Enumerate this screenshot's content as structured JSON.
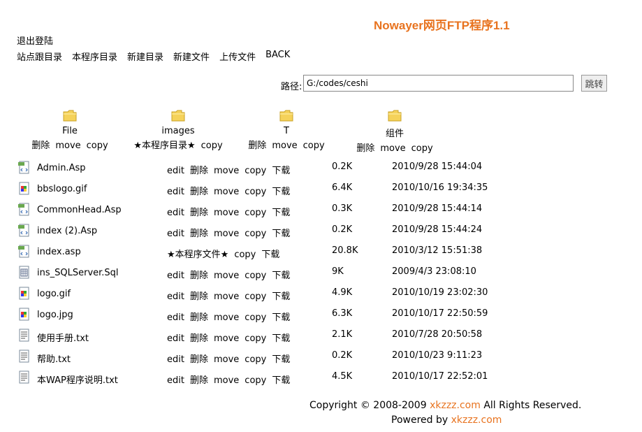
{
  "header": {
    "title": "Nowayer网页FTP程序1.1"
  },
  "top": {
    "logout": "退出登陆"
  },
  "nav": [
    "站点跟目录",
    "本程序目录",
    "新建目录",
    "新建文件",
    "上传文件",
    "BACK"
  ],
  "path": {
    "label": "路径:",
    "value": "G:/codes/ceshi",
    "go_label": "跳转"
  },
  "folders": [
    {
      "name": "File",
      "actions": [
        "删除",
        "move",
        "copy"
      ]
    },
    {
      "name": "images",
      "actions": [
        "★本程序目录★",
        "copy"
      ]
    },
    {
      "name": "T",
      "actions": [
        "删除",
        "move",
        "copy"
      ]
    },
    {
      "name": "组件",
      "actions": [
        "删除",
        "move",
        "copy"
      ]
    }
  ],
  "files": [
    {
      "name": "Admin.Asp",
      "icon": "asp-file-icon",
      "actions": [
        "edit",
        "删除",
        "move",
        "copy",
        "下载"
      ],
      "size": "0.2K",
      "date": "2010/9/28 15:44:04"
    },
    {
      "name": "bbslogo.gif",
      "icon": "image-file-icon",
      "actions": [
        "edit",
        "删除",
        "move",
        "copy",
        "下载"
      ],
      "size": "6.4K",
      "date": "2010/10/16 19:34:35"
    },
    {
      "name": "CommonHead.Asp",
      "icon": "asp-file-icon",
      "actions": [
        "edit",
        "删除",
        "move",
        "copy",
        "下载"
      ],
      "size": "0.3K",
      "date": "2010/9/28 15:44:14"
    },
    {
      "name": "index (2).Asp",
      "icon": "asp-file-icon",
      "actions": [
        "edit",
        "删除",
        "move",
        "copy",
        "下载"
      ],
      "size": "0.2K",
      "date": "2010/9/28 15:44:24"
    },
    {
      "name": "index.asp",
      "icon": "asp-file-icon",
      "actions": [
        "★本程序文件★",
        "copy",
        "下载"
      ],
      "size": "20.8K",
      "date": "2010/3/12 15:51:38"
    },
    {
      "name": "ins_SQLServer.Sql",
      "icon": "sql-file-icon",
      "actions": [
        "edit",
        "删除",
        "move",
        "copy",
        "下载"
      ],
      "size": "9K",
      "date": "2009/4/3 23:08:10"
    },
    {
      "name": "logo.gif",
      "icon": "image-file-icon",
      "actions": [
        "edit",
        "删除",
        "move",
        "copy",
        "下载"
      ],
      "size": "4.9K",
      "date": "2010/10/19 23:02:30"
    },
    {
      "name": "logo.jpg",
      "icon": "image-file-icon",
      "actions": [
        "edit",
        "删除",
        "move",
        "copy",
        "下载"
      ],
      "size": "6.3K",
      "date": "2010/10/17 22:50:59"
    },
    {
      "name": "使用手册.txt",
      "icon": "text-file-icon",
      "actions": [
        "edit",
        "删除",
        "move",
        "copy",
        "下载"
      ],
      "size": "2.1K",
      "date": "2010/7/28 20:50:58"
    },
    {
      "name": "帮助.txt",
      "icon": "text-file-icon",
      "actions": [
        "edit",
        "删除",
        "move",
        "copy",
        "下载"
      ],
      "size": "0.2K",
      "date": "2010/10/23 9:11:23"
    },
    {
      "name": "本WAP程序说明.txt",
      "icon": "text-file-icon",
      "actions": [
        "edit",
        "删除",
        "move",
        "copy",
        "下载"
      ],
      "size": "4.5K",
      "date": "2010/10/17 22:52:01"
    }
  ],
  "footer": {
    "copyright_prefix": "Copyright © 2008-2009",
    "copyright_link": "xkzzz.com",
    "copyright_suffix": "All Rights Reserved.",
    "powered_prefix": "Powered by",
    "powered_link": "xkzzz.com"
  },
  "colors": {
    "accent": "#e8731f",
    "folder": "#f5d25a"
  }
}
